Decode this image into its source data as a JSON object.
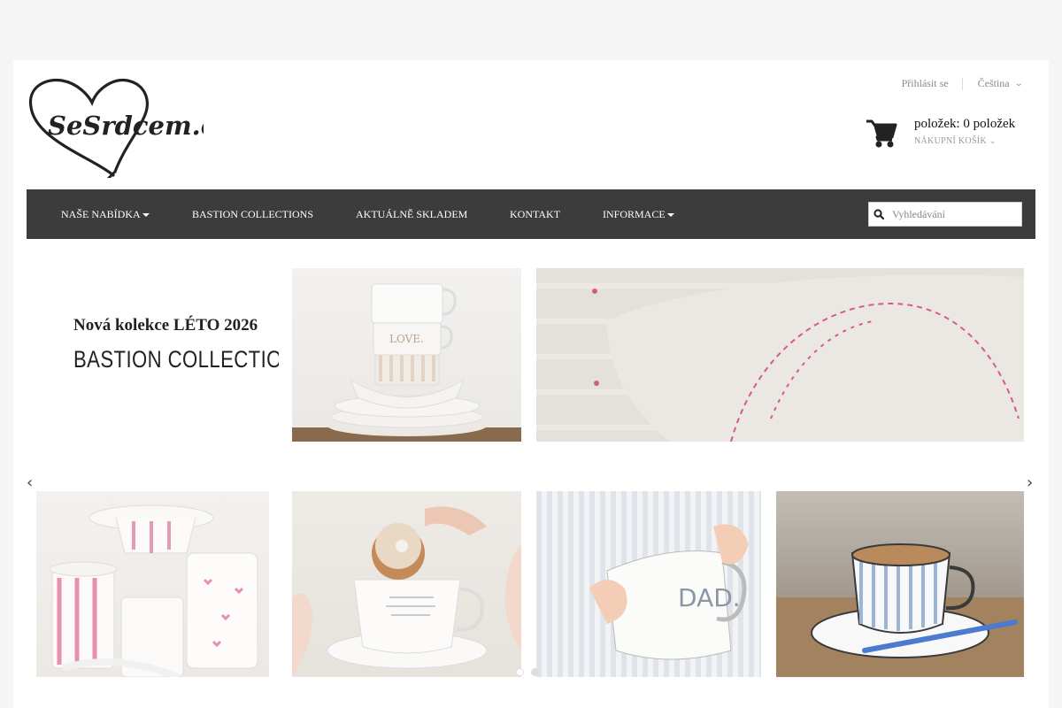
{
  "header": {
    "logo_text": "SeSrdcem.cz",
    "login_label": "Přihlásit se",
    "language_label": "Čeština"
  },
  "cart": {
    "count_text": "položek: 0 položek",
    "label": "NÁKUPNÍ KOŠÍK"
  },
  "nav": {
    "items": [
      {
        "label": "NAŠE NABÍDKA",
        "dropdown": true
      },
      {
        "label": "BASTION COLLECTIONS",
        "dropdown": false
      },
      {
        "label": "AKTUÁLNĚ SKLADEM",
        "dropdown": false
      },
      {
        "label": "KONTAKT",
        "dropdown": false
      },
      {
        "label": "INFORMACE",
        "dropdown": true
      }
    ],
    "search_placeholder": "Vyhledávání"
  },
  "slider": {
    "promo_line1": "Nová kolekce LÉTO 2026",
    "promo_line2": "BASTION COLLECTIONS",
    "slide_count": 2,
    "active_slide": 1
  },
  "icons": {
    "cart": "cart-icon",
    "search": "search-icon",
    "prev": "chevron-left-icon",
    "next": "chevron-right-icon",
    "language": "chevron-down-icon"
  }
}
